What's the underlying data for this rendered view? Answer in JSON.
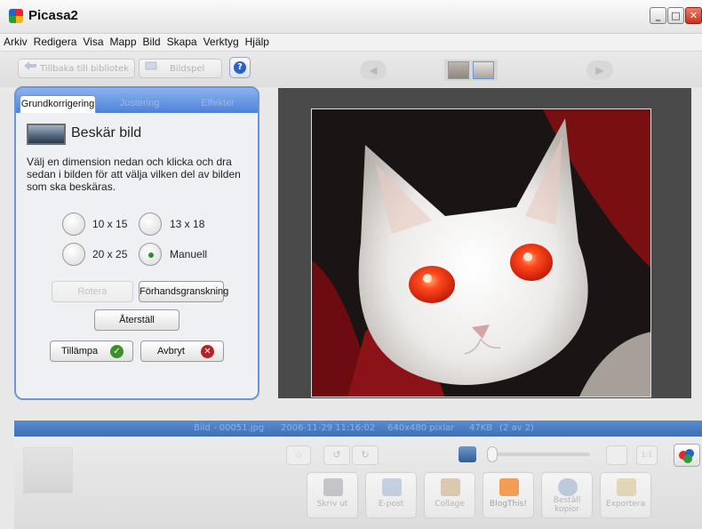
{
  "window": {
    "title": "Picasa2",
    "minimize": "_",
    "maximize": "□",
    "close": "✕"
  },
  "menu": [
    "Arkiv",
    "Redigera",
    "Visa",
    "Mapp",
    "Bild",
    "Skapa",
    "Verktyg",
    "Hjälp"
  ],
  "toolbar": {
    "back_label": "Tillbaka till bibliotek",
    "slideshow_label": "Bildspel",
    "help": "?"
  },
  "tabs": [
    "Grundkorrigering",
    "Justering",
    "Effekter"
  ],
  "crop": {
    "title": "Beskär bild",
    "description": "Välj en dimension nedan och klicka och dra sedan i bilden för att välja vilken del av bilden som ska beskäras.",
    "options": [
      {
        "label": "10 x 15",
        "checked": false
      },
      {
        "label": "13 x 18",
        "checked": false
      },
      {
        "label": "20 x 25",
        "checked": false
      },
      {
        "label": "Manuell",
        "checked": true
      }
    ],
    "rotate_label": "Rotera",
    "preview_label": "Förhandsgranskning",
    "reset_label": "Återställ",
    "apply_label": "Tillämpa",
    "cancel_label": "Avbryt"
  },
  "status": {
    "filename": "Bild - 00051.jpg",
    "datetime": "2006-11-29 11:16:02",
    "dimensions": "640x480 pixlar",
    "size": "47KB",
    "position": "(2 av 2)"
  },
  "tray": [
    "Skriv ut",
    "E-post",
    "Collage",
    "BlogThis!",
    "Beställ kopior",
    "Exportera"
  ],
  "colors": {
    "accent": "#4d82d9",
    "status_bar": "#4b7fc4",
    "eye_red": "#ff3a1a"
  }
}
